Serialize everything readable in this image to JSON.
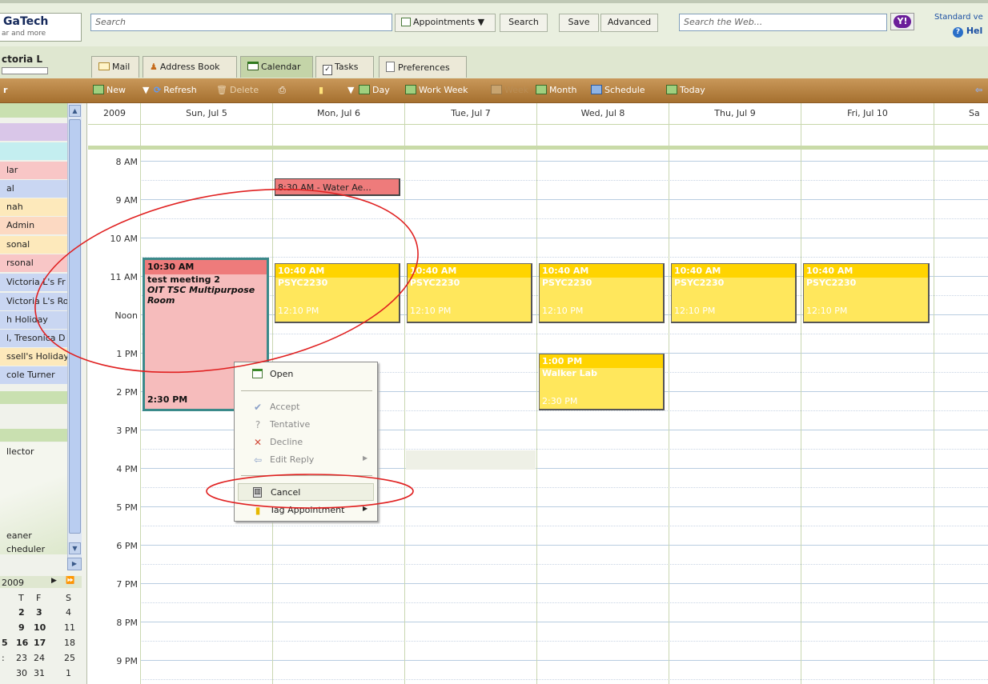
{
  "logo": {
    "title": "GaTech",
    "subtitle": "ar and more"
  },
  "search": {
    "placeholder": "Search",
    "scope": "Appointments",
    "search_btn": "Search",
    "save_btn": "Save",
    "advanced_btn": "Advanced"
  },
  "web_search": {
    "placeholder": "Search the Web...",
    "yahoo": "Y!"
  },
  "links": {
    "standard": "Standard ve",
    "help": "Hel"
  },
  "user": {
    "name": "ctoria L"
  },
  "tabs": [
    {
      "label": "Mail",
      "icon": "mail-icon"
    },
    {
      "label": "Address Book",
      "icon": "address-book-icon"
    },
    {
      "label": "Calendar",
      "icon": "calendar-icon"
    },
    {
      "label": "Tasks",
      "icon": "tasks-icon"
    },
    {
      "label": "Preferences",
      "icon": "preferences-icon"
    }
  ],
  "toolbar": {
    "new": "New",
    "refresh": "Refresh",
    "delete": "Delete",
    "day": "Day",
    "work_week": "Work Week",
    "week": "Week",
    "month": "Month",
    "schedule": "Schedule",
    "today": "Today"
  },
  "sidebar": {
    "collapsed_label": "r",
    "calendars": [
      {
        "label": "",
        "color": "#d9c6e8"
      },
      {
        "label": "",
        "color": "#c4eef0"
      },
      {
        "label": "lar",
        "color": "#f8c6c6"
      },
      {
        "label": "al",
        "color": "#c9d6f2"
      },
      {
        "label": "nah",
        "color": "#fde9bb"
      },
      {
        "label": "Admin",
        "color": "#fcd9c2"
      },
      {
        "label": "sonal",
        "color": "#fde9bb"
      },
      {
        "label": "rsonal",
        "color": "#f8c6c6"
      },
      {
        "label": "Victoria L's Fr",
        "color": "#c9d6f2"
      },
      {
        "label": "Victoria L's Ro",
        "color": "#c9d6f2"
      },
      {
        "label": "h Holiday",
        "color": "#c9d6f2"
      },
      {
        "label": "l, Tresonica D",
        "color": "#c9d6f2"
      },
      {
        "label": "ssell's Holiday",
        "color": "#fde9bb"
      },
      {
        "label": "cole Turner",
        "color": "#c9d6f2"
      }
    ],
    "zimlets": [
      {
        "label": "llector"
      },
      {
        "label": "eaner"
      },
      {
        "label": "cheduler"
      }
    ]
  },
  "mini_calendar": {
    "year": "2009",
    "headers": [
      "T",
      "F",
      "S"
    ],
    "rows": [
      [
        "2",
        "3",
        "4"
      ],
      [
        "9",
        "10",
        "11"
      ],
      [
        "16",
        "17",
        "18"
      ],
      [
        "23",
        "24",
        "25"
      ],
      [
        "30",
        "31",
        "1"
      ]
    ],
    "row_prefix": [
      "",
      "",
      "5",
      ":",
      ""
    ]
  },
  "calendar": {
    "year": "2009",
    "days": [
      "Sun, Jul 5",
      "Mon, Jul 6",
      "Tue, Jul 7",
      "Wed, Jul 8",
      "Thu, Jul 9",
      "Fri, Jul 10",
      "Sa"
    ],
    "hours": [
      "8 AM",
      "9 AM",
      "10 AM",
      "11 AM",
      "Noon",
      "1 PM",
      "2 PM",
      "3 PM",
      "4 PM",
      "5 PM",
      "6 PM",
      "7 PM",
      "8 PM",
      "9 PM"
    ]
  },
  "events": {
    "water": {
      "label": "8:30 AM - Water Ae..."
    },
    "test_meeting": {
      "start": "10:30 AM",
      "title": "test meeting 2",
      "location": "OIT TSC Multipurpose Room",
      "end": "2:30 PM"
    },
    "psyc": {
      "start": "10:40 AM",
      "title": "PSYC2230",
      "end": "12:10 PM"
    },
    "walker": {
      "start": "1:00 PM",
      "title": "Walker Lab",
      "end": "2:30 PM"
    }
  },
  "context_menu": {
    "open": "Open",
    "accept": "Accept",
    "tentative": "Tentative",
    "decline": "Decline",
    "edit_reply": "Edit Reply",
    "cancel": "Cancel",
    "tag": "Tag Appointment"
  }
}
